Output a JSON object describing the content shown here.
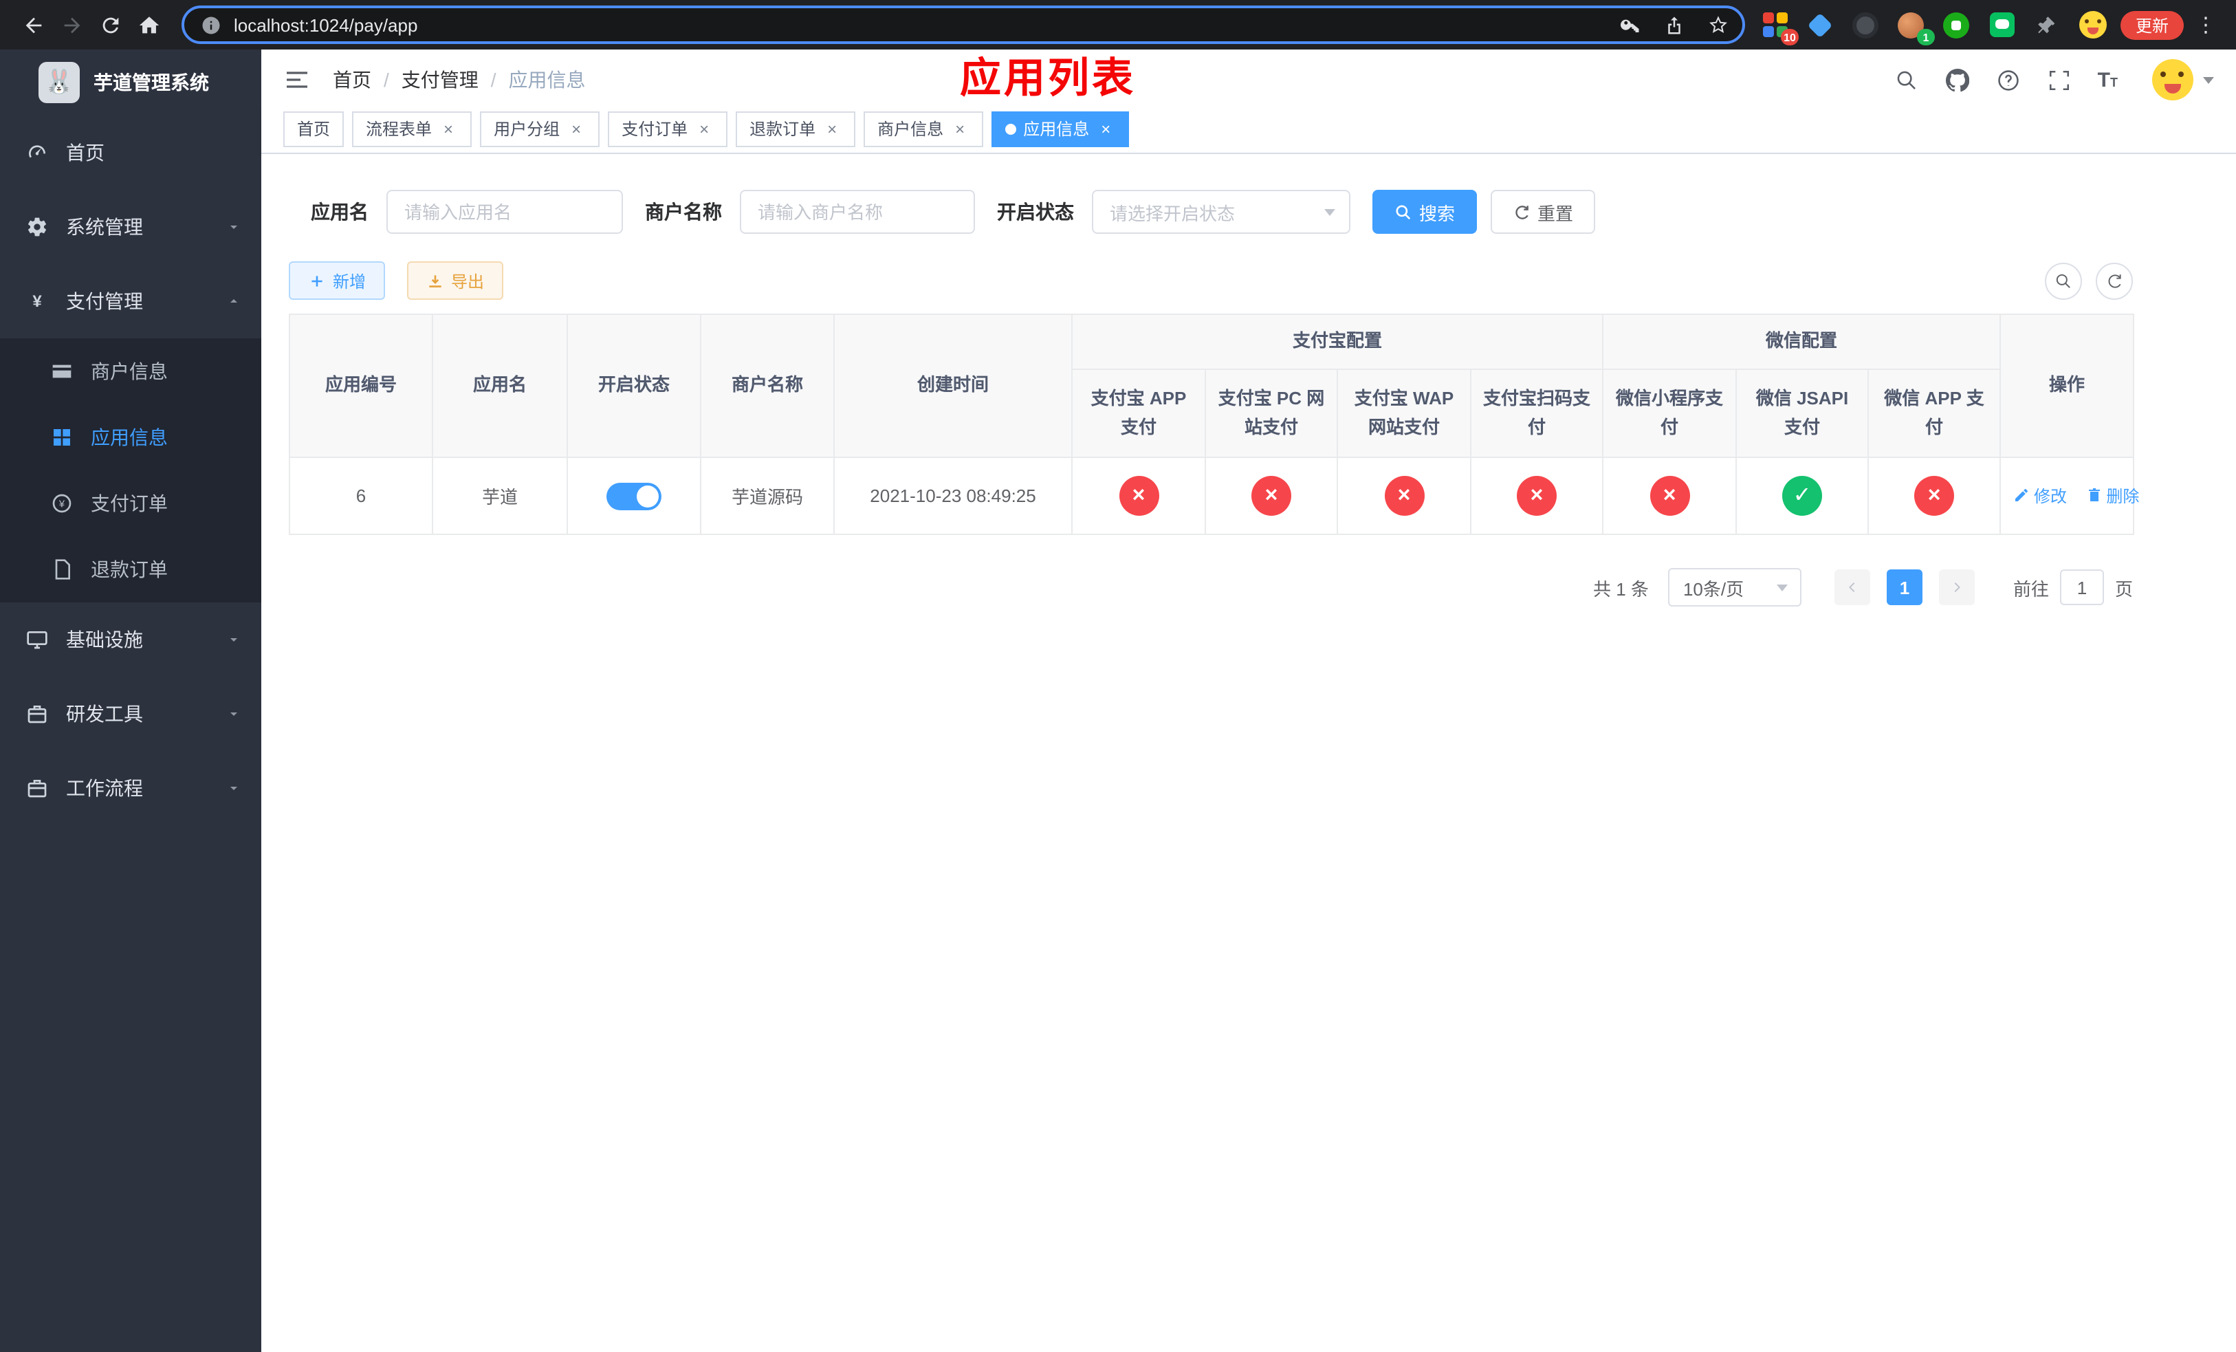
{
  "colors": {
    "accent": "#409eff",
    "tag-active": "#409eff",
    "danger": "#f6464b",
    "success": "#14c16e",
    "warning": "#e6a23c",
    "annotation": "#f40606"
  },
  "browser": {
    "url": "localhost:1024/pay/app",
    "update_button": "更新",
    "ext_badge_grid": "10",
    "ext_badge_avatar": "1"
  },
  "sidebar": {
    "logo_title": "芋道管理系统",
    "logo_emoji": "🐰",
    "items": [
      {
        "label": "首页"
      },
      {
        "label": "系统管理"
      },
      {
        "label": "支付管理"
      },
      {
        "label": "基础设施"
      },
      {
        "label": "研发工具"
      },
      {
        "label": "工作流程"
      }
    ],
    "payment_children": [
      {
        "label": "商户信息"
      },
      {
        "label": "应用信息"
      },
      {
        "label": "支付订单"
      },
      {
        "label": "退款订单"
      }
    ]
  },
  "navbar": {
    "breadcrumb": [
      "首页",
      "支付管理",
      "应用信息"
    ],
    "annotation": "应用列表"
  },
  "tabs": [
    {
      "label": "首页"
    },
    {
      "label": "流程表单"
    },
    {
      "label": "用户分组"
    },
    {
      "label": "支付订单"
    },
    {
      "label": "退款订单"
    },
    {
      "label": "商户信息"
    },
    {
      "label": "应用信息"
    }
  ],
  "filters": {
    "app_name_label": "应用名",
    "app_name_placeholder": "请输入应用名",
    "merchant_label": "商户名称",
    "merchant_placeholder": "请输入商户名称",
    "status_label": "开启状态",
    "status_placeholder": "请选择开启状态",
    "search_button": "搜索",
    "reset_button": "重置"
  },
  "toolbar": {
    "add_button": "新增",
    "export_button": "导出"
  },
  "table": {
    "group_alipay": "支付宝配置",
    "group_wechat": "微信配置",
    "columns": {
      "app_id": "应用编号",
      "app_name": "应用名",
      "status": "开启状态",
      "merchant": "商户名称",
      "created": "创建时间",
      "alipay_app": "支付宝 APP 支付",
      "alipay_pc": "支付宝 PC 网站支付",
      "alipay_wap": "支付宝 WAP 网站支付",
      "alipay_qr": "支付宝扫码支付",
      "wx_mini": "微信小程序支付",
      "wx_jsapi": "微信 JSAPI 支付",
      "wx_app": "微信 APP 支付",
      "actions": "操作"
    },
    "rows": [
      {
        "app_id": "6",
        "app_name": "芋道",
        "enabled": true,
        "merchant": "芋道源码",
        "created": "2021-10-23 08:49:25",
        "alipay_app": false,
        "alipay_pc": false,
        "alipay_wap": false,
        "alipay_qr": false,
        "wx_mini": false,
        "wx_jsapi": true,
        "wx_app": false,
        "edit_label": "修改",
        "delete_label": "删除"
      }
    ]
  },
  "pagination": {
    "total_text": "共 1 条",
    "page_size": "10条/页",
    "current_page": "1",
    "goto_label": "前往",
    "goto_value": "1",
    "goto_unit": "页"
  }
}
